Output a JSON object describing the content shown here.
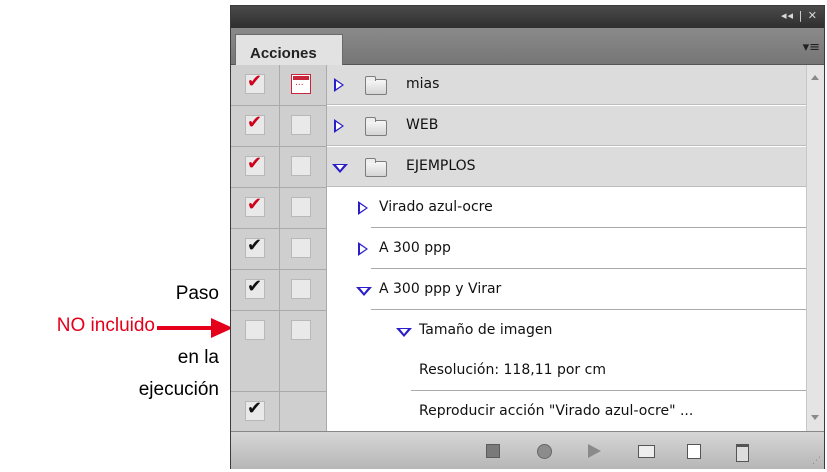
{
  "annotation": {
    "line1": "Paso",
    "line2": "NO incluido",
    "line3": "en la",
    "line4": "ejecución"
  },
  "panel": {
    "title_controls": "◂◂ | ✕",
    "tab_label": "Acciones",
    "menu_icon": "panel-menu-icon"
  },
  "rows": [
    {
      "type": "set",
      "expanded": false,
      "label": "mias",
      "check": "red",
      "dialog": true
    },
    {
      "type": "set",
      "expanded": false,
      "label": "WEB",
      "check": "red",
      "dialog": false
    },
    {
      "type": "set",
      "expanded": true,
      "label": "EJEMPLOS",
      "check": "red",
      "dialog": false
    },
    {
      "type": "action",
      "expanded": false,
      "label": "Virado azul-ocre",
      "check": "red",
      "dialog": false
    },
    {
      "type": "action",
      "expanded": false,
      "label": "A 300 ppp",
      "check": "black",
      "dialog": false
    },
    {
      "type": "action",
      "expanded": true,
      "label": "A 300 ppp y Virar",
      "check": "black",
      "dialog": false
    },
    {
      "type": "command",
      "expanded": true,
      "label": "Tamaño de imagen",
      "check": "none",
      "dialog": false
    },
    {
      "type": "detail",
      "label": "Resolución: 118,11 por cm"
    },
    {
      "type": "command",
      "expanded": false,
      "label": "Reproducir acción \"Virado azul-ocre\" ...",
      "check": "black",
      "dialog": false
    }
  ],
  "colors": {
    "check_red": "#d0001b",
    "triangle_blue": "#2a1ec8",
    "annotation_red": "#e4001b"
  },
  "bottom_buttons": [
    "stop-icon",
    "record-icon",
    "play-icon",
    "new-set-folder-icon",
    "new-action-icon",
    "delete-trash-icon"
  ]
}
